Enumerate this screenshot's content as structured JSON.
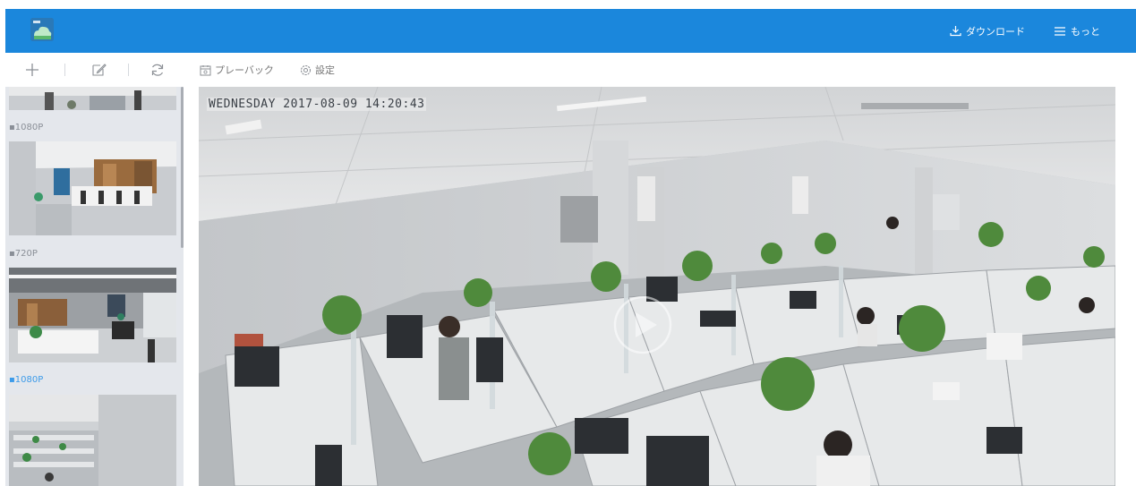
{
  "header": {
    "download_label": "ダウンロード",
    "more_label": "もっと",
    "logo_icon": "cloud-camera-logo-icon",
    "bg_color": "#1b87dc"
  },
  "toolbar": {
    "add_icon": "plus-icon",
    "edit_icon": "edit-icon",
    "refresh_icon": "refresh-icon",
    "playback_label": "プレーバック",
    "settings_label": "設定"
  },
  "sidebar": {
    "cameras": [
      {
        "label": ""
      },
      {
        "label": "1080P"
      },
      {
        "label": "720P"
      },
      {
        "label": "1080P",
        "active": true
      }
    ],
    "active_color": "#3d9be9"
  },
  "video": {
    "osd_text": "WEDNESDAY 2017-08-09 14:20:43",
    "play_icon": "play-icon"
  }
}
